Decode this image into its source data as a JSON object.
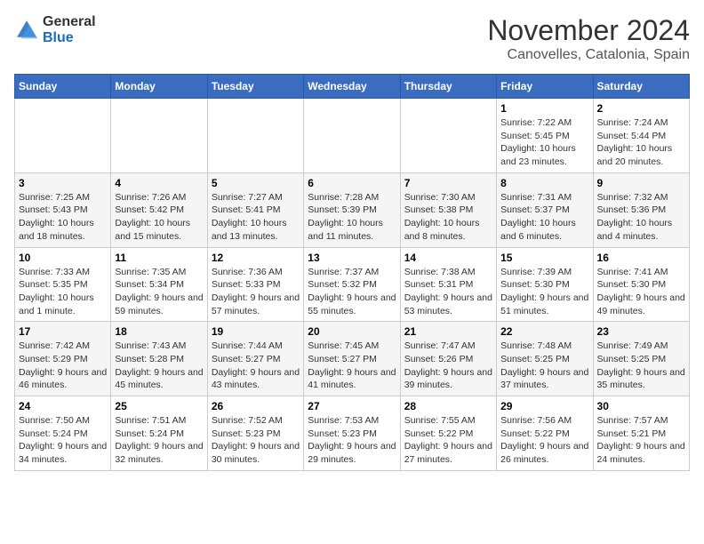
{
  "header": {
    "logo_general": "General",
    "logo_blue": "Blue",
    "month_title": "November 2024",
    "location": "Canovelles, Catalonia, Spain"
  },
  "days_of_week": [
    "Sunday",
    "Monday",
    "Tuesday",
    "Wednesday",
    "Thursday",
    "Friday",
    "Saturday"
  ],
  "weeks": [
    [
      {
        "day": "",
        "info": ""
      },
      {
        "day": "",
        "info": ""
      },
      {
        "day": "",
        "info": ""
      },
      {
        "day": "",
        "info": ""
      },
      {
        "day": "",
        "info": ""
      },
      {
        "day": "1",
        "info": "Sunrise: 7:22 AM\nSunset: 5:45 PM\nDaylight: 10 hours and 23 minutes."
      },
      {
        "day": "2",
        "info": "Sunrise: 7:24 AM\nSunset: 5:44 PM\nDaylight: 10 hours and 20 minutes."
      }
    ],
    [
      {
        "day": "3",
        "info": "Sunrise: 7:25 AM\nSunset: 5:43 PM\nDaylight: 10 hours and 18 minutes."
      },
      {
        "day": "4",
        "info": "Sunrise: 7:26 AM\nSunset: 5:42 PM\nDaylight: 10 hours and 15 minutes."
      },
      {
        "day": "5",
        "info": "Sunrise: 7:27 AM\nSunset: 5:41 PM\nDaylight: 10 hours and 13 minutes."
      },
      {
        "day": "6",
        "info": "Sunrise: 7:28 AM\nSunset: 5:39 PM\nDaylight: 10 hours and 11 minutes."
      },
      {
        "day": "7",
        "info": "Sunrise: 7:30 AM\nSunset: 5:38 PM\nDaylight: 10 hours and 8 minutes."
      },
      {
        "day": "8",
        "info": "Sunrise: 7:31 AM\nSunset: 5:37 PM\nDaylight: 10 hours and 6 minutes."
      },
      {
        "day": "9",
        "info": "Sunrise: 7:32 AM\nSunset: 5:36 PM\nDaylight: 10 hours and 4 minutes."
      }
    ],
    [
      {
        "day": "10",
        "info": "Sunrise: 7:33 AM\nSunset: 5:35 PM\nDaylight: 10 hours and 1 minute."
      },
      {
        "day": "11",
        "info": "Sunrise: 7:35 AM\nSunset: 5:34 PM\nDaylight: 9 hours and 59 minutes."
      },
      {
        "day": "12",
        "info": "Sunrise: 7:36 AM\nSunset: 5:33 PM\nDaylight: 9 hours and 57 minutes."
      },
      {
        "day": "13",
        "info": "Sunrise: 7:37 AM\nSunset: 5:32 PM\nDaylight: 9 hours and 55 minutes."
      },
      {
        "day": "14",
        "info": "Sunrise: 7:38 AM\nSunset: 5:31 PM\nDaylight: 9 hours and 53 minutes."
      },
      {
        "day": "15",
        "info": "Sunrise: 7:39 AM\nSunset: 5:30 PM\nDaylight: 9 hours and 51 minutes."
      },
      {
        "day": "16",
        "info": "Sunrise: 7:41 AM\nSunset: 5:30 PM\nDaylight: 9 hours and 49 minutes."
      }
    ],
    [
      {
        "day": "17",
        "info": "Sunrise: 7:42 AM\nSunset: 5:29 PM\nDaylight: 9 hours and 46 minutes."
      },
      {
        "day": "18",
        "info": "Sunrise: 7:43 AM\nSunset: 5:28 PM\nDaylight: 9 hours and 45 minutes."
      },
      {
        "day": "19",
        "info": "Sunrise: 7:44 AM\nSunset: 5:27 PM\nDaylight: 9 hours and 43 minutes."
      },
      {
        "day": "20",
        "info": "Sunrise: 7:45 AM\nSunset: 5:27 PM\nDaylight: 9 hours and 41 minutes."
      },
      {
        "day": "21",
        "info": "Sunrise: 7:47 AM\nSunset: 5:26 PM\nDaylight: 9 hours and 39 minutes."
      },
      {
        "day": "22",
        "info": "Sunrise: 7:48 AM\nSunset: 5:25 PM\nDaylight: 9 hours and 37 minutes."
      },
      {
        "day": "23",
        "info": "Sunrise: 7:49 AM\nSunset: 5:25 PM\nDaylight: 9 hours and 35 minutes."
      }
    ],
    [
      {
        "day": "24",
        "info": "Sunrise: 7:50 AM\nSunset: 5:24 PM\nDaylight: 9 hours and 34 minutes."
      },
      {
        "day": "25",
        "info": "Sunrise: 7:51 AM\nSunset: 5:24 PM\nDaylight: 9 hours and 32 minutes."
      },
      {
        "day": "26",
        "info": "Sunrise: 7:52 AM\nSunset: 5:23 PM\nDaylight: 9 hours and 30 minutes."
      },
      {
        "day": "27",
        "info": "Sunrise: 7:53 AM\nSunset: 5:23 PM\nDaylight: 9 hours and 29 minutes."
      },
      {
        "day": "28",
        "info": "Sunrise: 7:55 AM\nSunset: 5:22 PM\nDaylight: 9 hours and 27 minutes."
      },
      {
        "day": "29",
        "info": "Sunrise: 7:56 AM\nSunset: 5:22 PM\nDaylight: 9 hours and 26 minutes."
      },
      {
        "day": "30",
        "info": "Sunrise: 7:57 AM\nSunset: 5:21 PM\nDaylight: 9 hours and 24 minutes."
      }
    ]
  ]
}
